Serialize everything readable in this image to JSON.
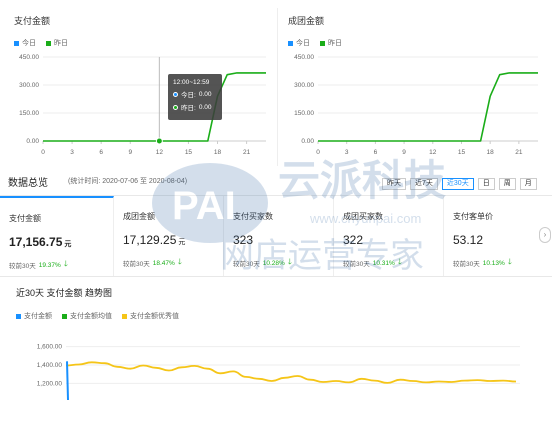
{
  "chart1": {
    "title": "支付金额",
    "legend": [
      {
        "label": "今日",
        "color": "#1890ff"
      },
      {
        "label": "昨日",
        "color": "#1aad19"
      }
    ],
    "tooltip": {
      "time": "12:00~12:59",
      "today_label": "今日: ",
      "today_value": "0.00",
      "yday_label": "昨日: ",
      "yday_value": "0.00"
    }
  },
  "chart2": {
    "title": "成团金额",
    "legend": [
      {
        "label": "今日",
        "color": "#1890ff"
      },
      {
        "label": "昨日",
        "color": "#1aad19"
      }
    ]
  },
  "overview": {
    "title": "数据总览",
    "range": "(统计时间: 2020-07-06 至 2020-08-04)",
    "tabs": [
      "昨天",
      "近7天",
      "近30天",
      "日",
      "周",
      "月"
    ],
    "active_tab": "近30天"
  },
  "cards": [
    {
      "label": "支付金额",
      "value": "17,156.75",
      "unit": "元",
      "cmp_label": "较前30天",
      "pct": "19.37%"
    },
    {
      "label": "成团金额",
      "value": "17,129.25",
      "unit": "元",
      "cmp_label": "较前30天",
      "pct": "18.47%"
    },
    {
      "label": "支付买家数",
      "value": "323",
      "unit": "",
      "cmp_label": "较前30天",
      "pct": "10.28%"
    },
    {
      "label": "成团买家数",
      "value": "322",
      "unit": "",
      "cmp_label": "较前30天",
      "pct": "10.31%"
    },
    {
      "label": "支付客单价",
      "value": "53.12",
      "unit": "",
      "cmp_label": "较前30天",
      "pct": "10.13%"
    }
  ],
  "trend": {
    "title": "近30天 支付金额 趋势图",
    "legend": [
      {
        "label": "支付金额",
        "color": "#1890ff"
      },
      {
        "label": "支付金额均值",
        "color": "#1aad19"
      },
      {
        "label": "支付金额优秀值",
        "color": "#f5c518"
      }
    ]
  },
  "watermark": {
    "brand": "PAI",
    "cn_name": "云派科技",
    "url": "www.cnyunpai.com",
    "slogan": "网店运营专家"
  },
  "chart_data": [
    {
      "type": "line",
      "title": "支付金额",
      "x": [
        0,
        1,
        2,
        3,
        4,
        5,
        6,
        7,
        8,
        9,
        10,
        11,
        12,
        13,
        14,
        15,
        16,
        17,
        18,
        19,
        20,
        21,
        22,
        23
      ],
      "xticks": [
        "0",
        "3",
        "6",
        "9",
        "12",
        "15",
        "18",
        "21"
      ],
      "ylim": [
        0,
        450
      ],
      "yticks": [
        "0.00",
        "150.00",
        "300.00",
        "450.00"
      ],
      "series": [
        {
          "name": "昨日",
          "color": "#1aad19",
          "values": [
            0,
            0,
            0,
            0,
            0,
            0,
            0,
            0,
            0,
            0,
            0,
            0,
            0,
            0,
            0,
            0,
            0,
            0,
            240,
            355,
            365,
            365,
            365,
            365
          ]
        }
      ]
    },
    {
      "type": "line",
      "title": "成团金额",
      "x": [
        0,
        1,
        2,
        3,
        4,
        5,
        6,
        7,
        8,
        9,
        10,
        11,
        12,
        13,
        14,
        15,
        16,
        17,
        18,
        19,
        20,
        21,
        22,
        23
      ],
      "xticks": [
        "0",
        "3",
        "6",
        "9",
        "12",
        "15",
        "18",
        "21"
      ],
      "ylim": [
        0,
        450
      ],
      "yticks": [
        "0.00",
        "150.00",
        "300.00",
        "450.00"
      ],
      "series": [
        {
          "name": "昨日",
          "color": "#1aad19",
          "values": [
            0,
            0,
            0,
            0,
            0,
            0,
            0,
            0,
            0,
            0,
            0,
            0,
            0,
            0,
            0,
            0,
            0,
            0,
            240,
            355,
            365,
            365,
            365,
            365
          ]
        }
      ]
    },
    {
      "type": "line",
      "title": "近30天 支付金额 趋势图",
      "ylim": [
        1160,
        1640
      ],
      "yticks": [
        "1,200.00",
        "1,400.00",
        "1,600.00"
      ],
      "series": [
        {
          "name": "支付金额优秀值",
          "color": "#f5c518",
          "values": [
            1395,
            1405,
            1430,
            1420,
            1380,
            1360,
            1395,
            1370,
            1340,
            1375,
            1390,
            1360,
            1310,
            1330,
            1270,
            1250,
            1225,
            1260,
            1280,
            1240,
            1215,
            1225,
            1210,
            1250,
            1230,
            1205,
            1240,
            1225,
            1210,
            1220,
            1215,
            1230,
            1235,
            1225,
            1230,
            1220
          ]
        },
        {
          "name": "支付金额",
          "color": "#1890ff",
          "values": [
            1440,
            1000
          ]
        }
      ]
    }
  ]
}
